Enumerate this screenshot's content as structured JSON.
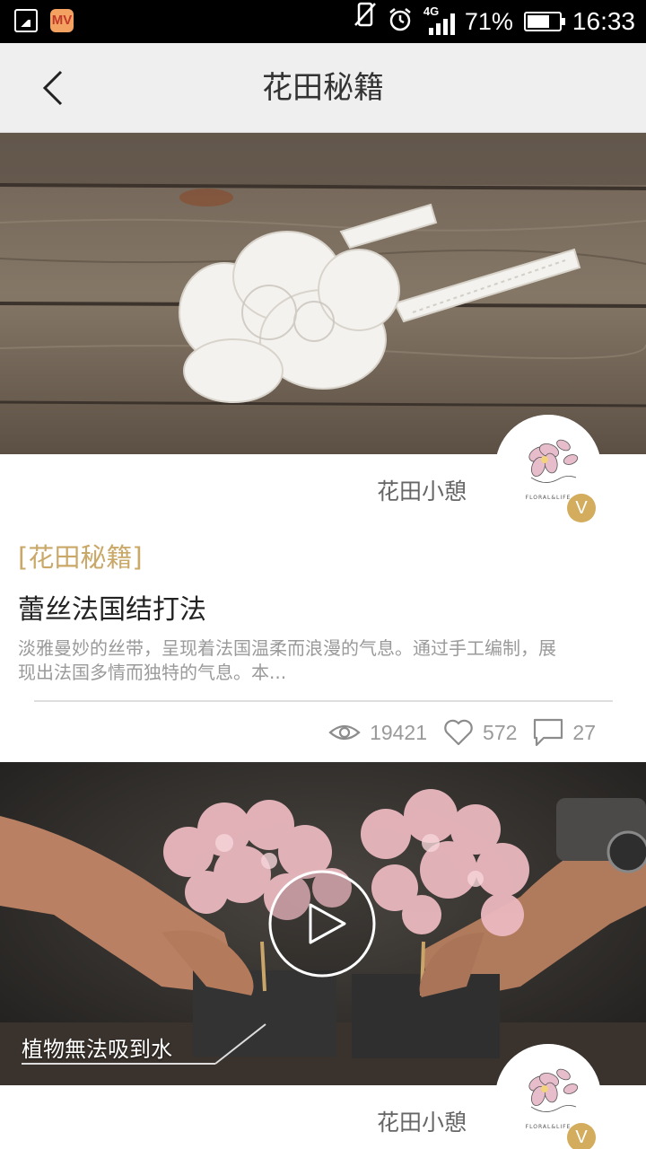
{
  "status_bar": {
    "network": "4G",
    "battery": "71%",
    "battery_level": 0.71,
    "time": "16:33",
    "app_icon_text": "MV",
    "icons": [
      "gallery-icon",
      "app-icon",
      "vibrate-icon",
      "alarm-icon",
      "signal-icon",
      "battery-icon"
    ]
  },
  "header": {
    "title": "花田秘籍",
    "back_icon": "chevron-left-icon"
  },
  "feed": [
    {
      "author": "花田小憩",
      "avatar_text": "FLORAL&LIFE",
      "verified_badge": "V",
      "category": "[花田秘籍]",
      "title": "蕾丝法国结打法",
      "excerpt": "淡雅曼妙的丝带，呈现着法国温柔而浪漫的气息。通过手工编制，展现出法国多情而独特的气息。本...",
      "views": "19421",
      "likes": "572",
      "comments": "27"
    },
    {
      "author": "花田小憩",
      "avatar_text": "FLORAL&LIFE",
      "verified_badge": "V",
      "video_caption": "植物無法吸到水"
    }
  ],
  "colors": {
    "accent_gold": "#c9a868",
    "badge_gold": "#d3ac5d",
    "title_bar": "#efefef"
  }
}
